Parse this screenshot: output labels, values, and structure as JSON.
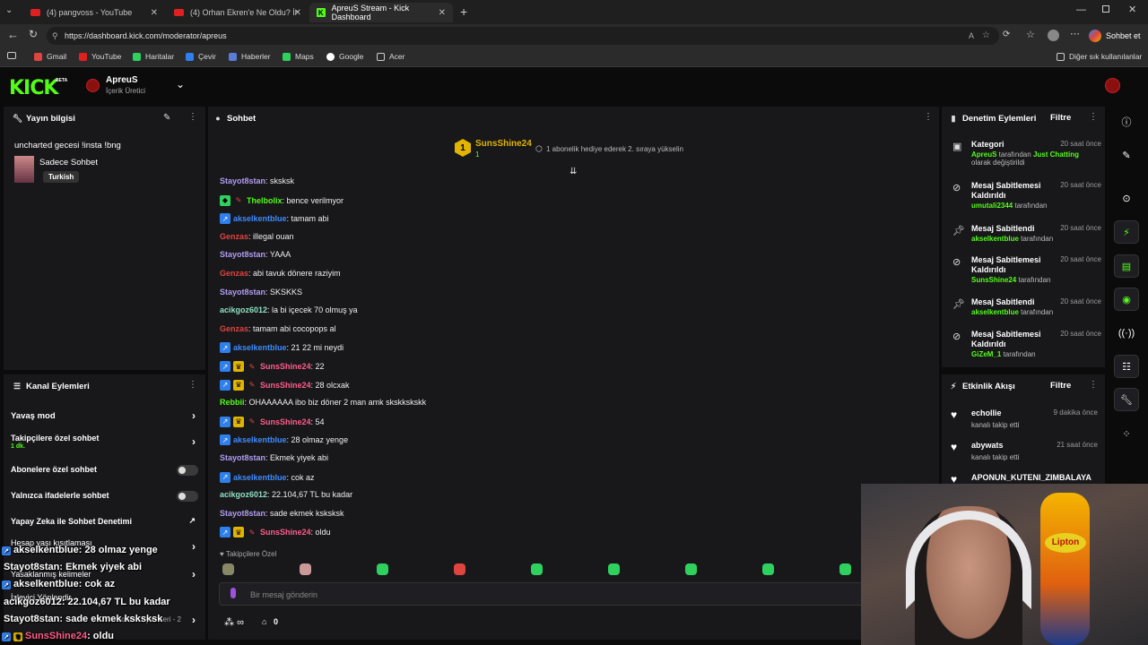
{
  "browser": {
    "tabs": [
      {
        "label": "(4) pangvoss - YouTube"
      },
      {
        "label": "(4) Orhan Ekren'e Ne Oldu? İngilte"
      },
      {
        "label": "ApreuS Stream - Kick Dashboard"
      }
    ],
    "url": "https://dashboard.kick.com/moderator/apreus",
    "profile_label": "Sohbet et",
    "bookmarks": [
      "Gmail",
      "YouTube",
      "Haritalar",
      "Çevir",
      "Haberler",
      "Maps",
      "Google",
      "Acer"
    ],
    "other_bookmarks": "Diğer sık kullanılanlar"
  },
  "header": {
    "logo": "KICK",
    "beta": "BETA",
    "channel_name": "ApreuS",
    "channel_role": "İçerik Üretici"
  },
  "stream_info": {
    "title": "Yayın bilgisi",
    "stream_title": "uncharted gecesi !insta !bng",
    "category": "Sadece Sohbet",
    "language_tag": "Turkish"
  },
  "channel_actions": {
    "title": "Kanal Eylemleri",
    "items": [
      {
        "label": "Yavaş mod",
        "sub": ""
      },
      {
        "label": "Takipçilere özel sohbet",
        "sub": "1 dk."
      },
      {
        "label": "Abonelere özel sohbet",
        "sub": ""
      },
      {
        "label": "Yalnızca ifadelerle sohbet",
        "sub": ""
      },
      {
        "label": "Yapay Zeka ile Sohbet Denetimi",
        "sub": ""
      },
      {
        "label": "Hesap yaşı kısıtlaması",
        "sub": ""
      },
      {
        "label": "Yasaklanmış kelimeler",
        "sub": ""
      },
      {
        "label": "İzleyici Yönlendir",
        "sub": ""
      },
      {
        "label": "Sohbet Eylemleri - 2",
        "sub": ""
      }
    ]
  },
  "chat": {
    "title": "Sohbet",
    "pinned": {
      "user": "SunsShine24",
      "rank": "1",
      "count": "1",
      "text": "1 abonelik hediye ederek 2. sıraya yükselin"
    },
    "messages": [
      {
        "user": "Stayot8stan",
        "text": ": sksksk",
        "color": "#b19cf0",
        "badges": []
      },
      {
        "user": "Thelbolix",
        "text": ": bence verilmyor",
        "color": "#53fc18",
        "badges": [
          "green",
          "pin"
        ]
      },
      {
        "user": "akselkentblue",
        "text": ": tamam abi",
        "color": "#3d8bff",
        "badges": [
          "blue"
        ]
      },
      {
        "user": "Genzas",
        "text": ": illegal ouan",
        "color": "#e0443e",
        "badges": []
      },
      {
        "user": "Stayot8stan",
        "text": ": YAAA",
        "color": "#b19cf0",
        "badges": []
      },
      {
        "user": "Genzas",
        "text": ": abi tavuk dönere raziyim",
        "color": "#e0443e",
        "badges": []
      },
      {
        "user": "Stayot8stan",
        "text": ": SKSKKS",
        "color": "#b19cf0",
        "badges": []
      },
      {
        "user": "acikgoz6012",
        "text": ": la bi içecek 70 olmuş ya",
        "color": "#8fe0c0",
        "badges": []
      },
      {
        "user": "Genzas",
        "text": ": tamam abi cocopops al",
        "color": "#e0443e",
        "badges": []
      },
      {
        "user": "akselkentblue",
        "text": ": 21 22 mi neydi",
        "color": "#3d8bff",
        "badges": [
          "blue"
        ]
      },
      {
        "user": "SunsShine24",
        "text": ": 22",
        "color": "#ff5c8a",
        "badges": [
          "blue",
          "gold",
          "pin"
        ]
      },
      {
        "user": "SunsShine24",
        "text": ": 28 olcxak",
        "color": "#ff5c8a",
        "badges": [
          "blue",
          "gold",
          "pin"
        ]
      },
      {
        "user": "Rebbii",
        "text": ": OHAAAAAA ibo biz döner 2 man amk skskkskskk",
        "color": "#53fc18",
        "badges": []
      },
      {
        "user": "SunsShine24",
        "text": ": 54",
        "color": "#ff5c8a",
        "badges": [
          "blue",
          "gold",
          "pin"
        ]
      },
      {
        "user": "akselkentblue",
        "text": ": 28 olmaz yenge",
        "color": "#3d8bff",
        "badges": [
          "blue"
        ]
      },
      {
        "user": "Stayot8stan",
        "text": ": Ekmek yiyek abi",
        "color": "#b19cf0",
        "badges": []
      },
      {
        "user": "akselkentblue",
        "text": ": cok az",
        "color": "#3d8bff",
        "badges": [
          "blue"
        ]
      },
      {
        "user": "acikgoz6012",
        "text": ": 22.104,67 TL bu kadar",
        "color": "#8fe0c0",
        "badges": []
      },
      {
        "user": "Stayot8stan",
        "text": ": sade ekmek ksksksk",
        "color": "#b19cf0",
        "badges": []
      },
      {
        "user": "SunsShine24",
        "text": ": oldu",
        "color": "#ff5c8a",
        "badges": [
          "blue",
          "gold",
          "pin"
        ]
      }
    ],
    "emote_section_label": "Takipçilere Özel",
    "input_placeholder": "Bir mesaj gönderin",
    "footer_infinity": "∞",
    "footer_count": "0"
  },
  "mod_actions": {
    "title": "Denetim Eylemleri",
    "filter": "Filtre",
    "items": [
      {
        "title": "Kategori",
        "time": "20 saat önce",
        "sub": [
          "ApreuS",
          " tarafından ",
          "Just Chatting",
          " olarak değiştirildi"
        ],
        "icon": "category-icon"
      },
      {
        "title": "Mesaj Sabitlemesi Kaldırıldı",
        "time": "20 saat önce",
        "sub": [
          "umutali2344",
          " tarafından"
        ],
        "icon": "unpin-icon"
      },
      {
        "title": "Mesaj Sabitlendi",
        "time": "20 saat önce",
        "sub": [
          "akselkentblue",
          " tarafından"
        ],
        "icon": "pin-icon"
      },
      {
        "title": "Mesaj Sabitlemesi Kaldırıldı",
        "time": "20 saat önce",
        "sub": [
          "SunsShine24",
          " tarafından"
        ],
        "icon": "unpin-icon"
      },
      {
        "title": "Mesaj Sabitlendi",
        "time": "20 saat önce",
        "sub": [
          "akselkentblue",
          " tarafından"
        ],
        "icon": "pin-icon"
      },
      {
        "title": "Mesaj Sabitlemesi Kaldırıldı",
        "time": "20 saat önce",
        "sub": [
          "GiZeM_1",
          " tarafından"
        ],
        "icon": "unpin-icon"
      }
    ]
  },
  "activity": {
    "title": "Etkinlik Akışı",
    "filter": "Filtre",
    "items": [
      {
        "user": "echollie",
        "text": "kanalı takip etti",
        "time": "9 dakika önce"
      },
      {
        "user": "abywats",
        "text": "kanalı takip etti",
        "time": "21 saat önce"
      },
      {
        "user": "APONUN_KUTENI_ZIMBALAYA",
        "text": "",
        "time": ""
      }
    ]
  },
  "overlay_chat": [
    {
      "user": "akselkentblue",
      "text": ": 28 olmaz yenge"
    },
    {
      "user": "Stayot8stan",
      "text": ": Ekmek yiyek abi"
    },
    {
      "user": "akselkentblue",
      "text": ": cok az"
    },
    {
      "user": "acikgoz6012",
      "text": ": 22.104,67 TL bu kadar"
    },
    {
      "user": "Stayot8stan",
      "text": ": sade ekmek ksksksk"
    },
    {
      "user": "SunsShine24",
      "text": ": oldu"
    }
  ],
  "webcam": {
    "bottle_label": "Lipton"
  },
  "colors": {
    "kick_green": "#53fc18",
    "panel": "#18181b",
    "background": "#0b0b0c"
  }
}
